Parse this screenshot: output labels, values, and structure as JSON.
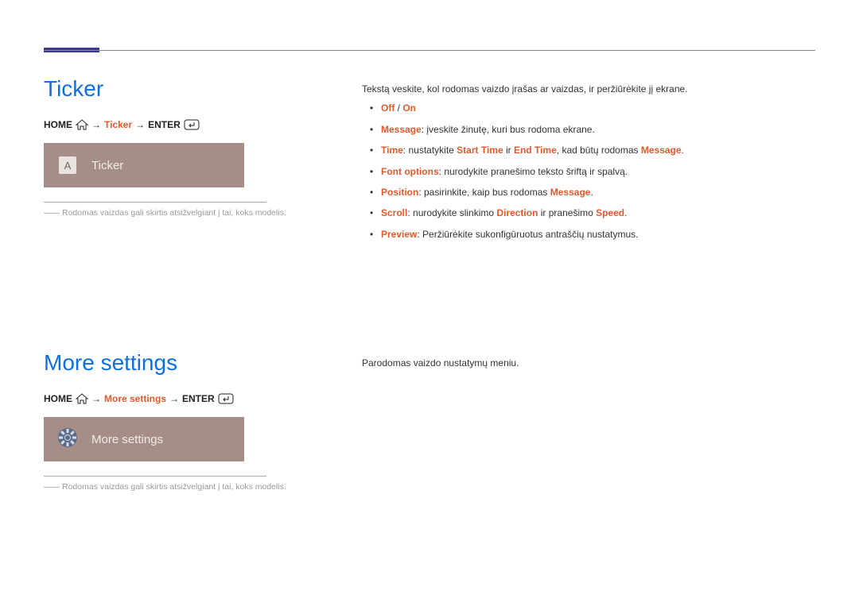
{
  "section1": {
    "title": "Ticker",
    "breadcrumb": {
      "home": "HOME",
      "item": "Ticker",
      "enter": "ENTER"
    },
    "tile": {
      "iconLetter": "A",
      "label": "Ticker"
    },
    "footnote": "Rodomas vaizdas gali skirtis atsižvelgiant į tai, koks modelis.",
    "intro": "Tekstą veskite, kol rodomas vaizdo įrašas ar vaizdas, ir peržiūrėkite jį ekrane.",
    "items": {
      "offOn": {
        "off": "Off",
        "sep": " / ",
        "on": "On"
      },
      "message": {
        "label": "Message",
        "text": ": įveskite žinutę, kuri bus rodoma ekrane."
      },
      "time": {
        "label": "Time",
        "t1": ": nustatykite ",
        "start": "Start Time",
        "t2": " ir ",
        "end": "End Time",
        "t3": ", kad būtų rodomas ",
        "msg": "Message",
        "t4": "."
      },
      "font": {
        "label": "Font options",
        "text": ": nurodykite pranešimo teksto šriftą ir spalvą."
      },
      "position": {
        "label": "Position",
        "t1": ": pasirinkite, kaip bus rodomas ",
        "msg": "Message",
        "t2": "."
      },
      "scroll": {
        "label": "Scroll",
        "t1": ": nurodykite slinkimo ",
        "dir": "Direction",
        "t2": " ir pranešimo ",
        "speed": "Speed",
        "t3": "."
      },
      "preview": {
        "label": "Preview",
        "text": ": Peržiūrėkite sukonfigūruotus antraščių nustatymus."
      }
    }
  },
  "section2": {
    "title": "More settings",
    "breadcrumb": {
      "home": "HOME",
      "item": "More settings",
      "enter": "ENTER"
    },
    "tile": {
      "label": "More settings"
    },
    "footnote": "Rodomas vaizdas gali skirtis atsižvelgiant į tai, koks modelis.",
    "intro": "Parodomas vaizdo nustatymų meniu."
  }
}
